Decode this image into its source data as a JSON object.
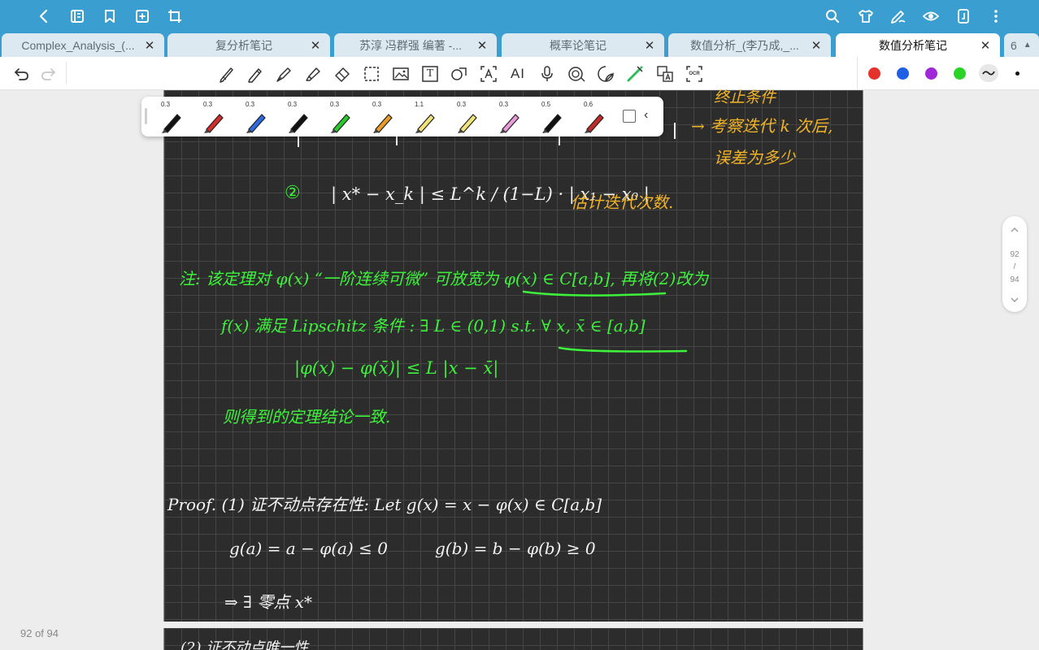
{
  "top_toolbar": {
    "left_icons": [
      "back-icon",
      "notebook-icon",
      "bookmark-icon",
      "add-page-icon",
      "crop-icon"
    ],
    "right_icons": [
      "search-icon",
      "shirt-icon",
      "pen-mode-icon",
      "eye-icon",
      "tablet-icon",
      "more-vert-icon"
    ]
  },
  "tabs": [
    {
      "label": "Complex_Analysis_(...",
      "active": false
    },
    {
      "label": "复分析笔记",
      "active": false
    },
    {
      "label": "苏淳 冯群强 编著 -...",
      "active": false
    },
    {
      "label": "概率论笔记",
      "active": false
    },
    {
      "label": "数值分析_(李乃成,_...",
      "active": false
    },
    {
      "label": "数值分析笔记",
      "active": true
    }
  ],
  "tab_overflow_count": "6",
  "drawing_tools": [
    "undo-icon",
    "redo-icon",
    "pencil-icon",
    "pen-icon",
    "fountain-pen-icon",
    "highlighter-icon",
    "eraser-icon",
    "lasso-select-icon",
    "image-icon",
    "text-box-icon",
    "shape-icon",
    "text-recognition-icon",
    "ai-icon",
    "microphone-icon",
    "audio-record-icon",
    "sticker-icon",
    "laser-pointer-icon",
    "translate-icon",
    "ocr-icon"
  ],
  "ocr_label": "OCR",
  "ai_label": "AI",
  "text_tool_label": "T",
  "color_swatches": [
    "#e3312b",
    "#1f5fe6",
    "#a128d6",
    "#2bd329"
  ],
  "pens": [
    {
      "width": "0.3",
      "color": "#111111"
    },
    {
      "width": "0.3",
      "color": "#d42b2b"
    },
    {
      "width": "0.3",
      "color": "#2d6ae0"
    },
    {
      "width": "0.3",
      "color": "#111111"
    },
    {
      "width": "0.3",
      "color": "#2bc92b"
    },
    {
      "width": "0.3",
      "color": "#e99a28"
    },
    {
      "width": "1.1",
      "color": "#f2e27a"
    },
    {
      "width": "0.3",
      "color": "#f2e27a"
    },
    {
      "width": "0.3",
      "color": "#e99ad8"
    },
    {
      "width": "0.5",
      "color": "#111111"
    },
    {
      "width": "0.6",
      "color": "#c42828"
    }
  ],
  "notes": {
    "top_right_1": "终止条件",
    "top_right_2": "→ 考察迭代 k 次后,",
    "top_right_3": "误差为多少",
    "item2_marker": "②",
    "item2_formula": "| x* − x_k | ≤ L^k / (1−L) · | x₁ − x₀ |",
    "item2_note": "估计迭代次数.",
    "note_line1": "注: 该定理对 φ(x) “一阶连续可微” 可放宽为 φ(x) ∈ C[a,b], 再将(2)改为",
    "note_line2": "f(x) 满足 Lipschitz 条件 :  ∃ L ∈ (0,1) s.t.   ∀ x, x̄ ∈ [a,b]",
    "note_line3": "|φ(x) − φ(x̄)| ≤ L |x − x̄|",
    "note_line4": "则得到的定理结论一致.",
    "proof_line1": "Proof.  (1) 证不动点存在性:   Let  g(x) = x − φ(x) ∈ C[a,b]",
    "proof_line2a": "g(a) = a − φ(a) ≤ 0",
    "proof_line2b": "g(b) = b − φ(b) ≥ 0",
    "proof_line3": "⇒ ∃ 零点 x*",
    "next_page_line": "(2) 证不动点唯一性"
  },
  "page_scroll": {
    "current": "92",
    "separator": "/",
    "total": "94"
  },
  "footer_page_label": "92 of 94"
}
